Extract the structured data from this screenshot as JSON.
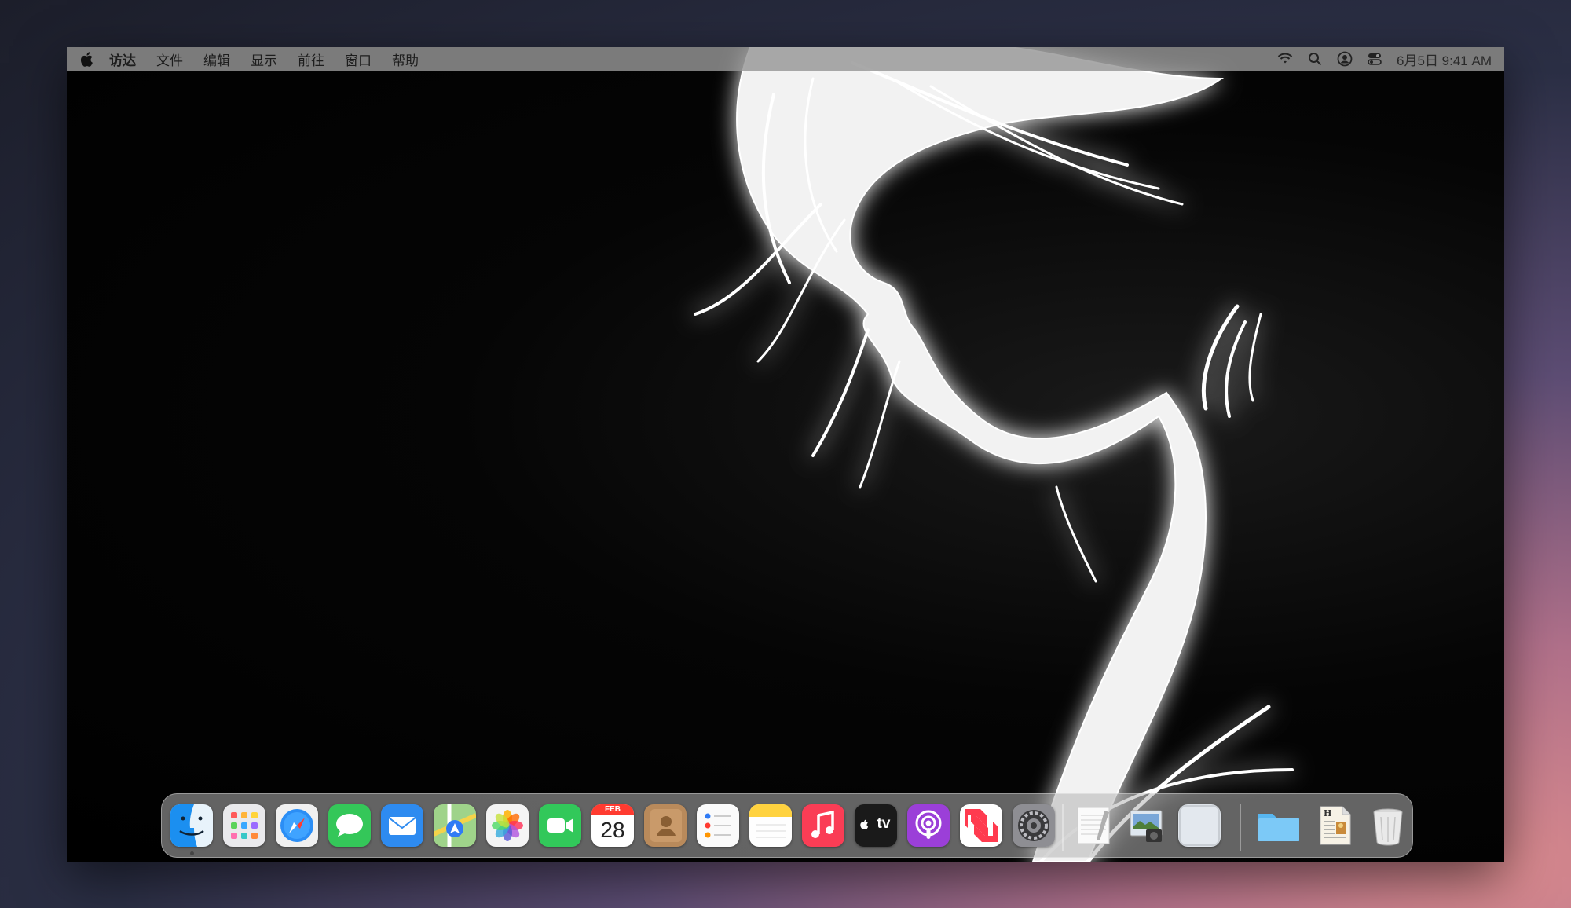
{
  "menubar": {
    "apple_icon": "apple-logo-icon",
    "items": [
      "访达",
      "文件",
      "编辑",
      "显示",
      "前往",
      "窗口",
      "帮助"
    ],
    "status_icons": [
      "wifi-icon",
      "search-icon",
      "user-icon",
      "control-center-icon"
    ],
    "datetime": "6月5日  9:41 AM"
  },
  "dock": {
    "apps": [
      "finder",
      "launchpad",
      "safari",
      "messages",
      "mail",
      "maps",
      "photos",
      "facetime",
      "calendar",
      "contacts",
      "reminders",
      "notes",
      "music",
      "tv",
      "podcasts",
      "news",
      "system-settings",
      "textedit",
      "preview",
      "blank-window",
      "folder",
      "document",
      "trash"
    ],
    "calendar": {
      "month": "FEB",
      "day": "28"
    },
    "tv_label": "tv"
  },
  "colors": {
    "menubar": "#969696",
    "desktop_background": "#000000",
    "dock": "#b4b4b4"
  }
}
